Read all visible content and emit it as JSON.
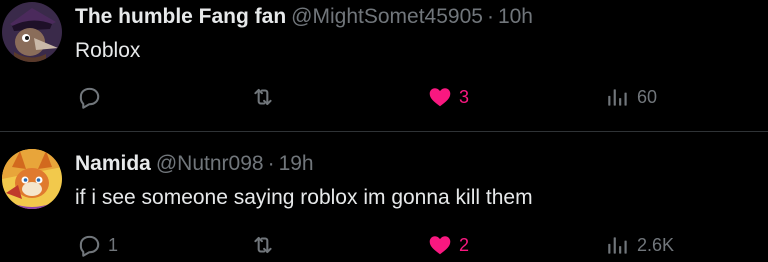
{
  "colors": {
    "background": "#000000",
    "text_primary": "#e7e9ea",
    "text_secondary": "#71767b",
    "like_active": "#f91880",
    "divider": "#2f3336"
  },
  "tweets": [
    {
      "display_name": "The humble Fang fan",
      "handle": "@MightSomet45905",
      "separator": "·",
      "time": "10h",
      "text": "Roblox",
      "actions": {
        "reply_icon": "reply-icon",
        "reply_count": "",
        "repost_icon": "repost-icon",
        "repost_count": "",
        "like_icon": "heart-filled-icon",
        "like_count": "3",
        "views_icon": "views-bar-chart-icon",
        "views_count": "60"
      }
    },
    {
      "display_name": "Namida",
      "handle": "@Nutnr098",
      "separator": "·",
      "time": "19h",
      "text": "if i see someone saying roblox im gonna kill them",
      "actions": {
        "reply_icon": "reply-icon",
        "reply_count": "1",
        "repost_icon": "repost-icon",
        "repost_count": "",
        "like_icon": "heart-filled-icon",
        "like_count": "2",
        "views_icon": "views-bar-chart-icon",
        "views_count": "2.6K"
      }
    }
  ]
}
